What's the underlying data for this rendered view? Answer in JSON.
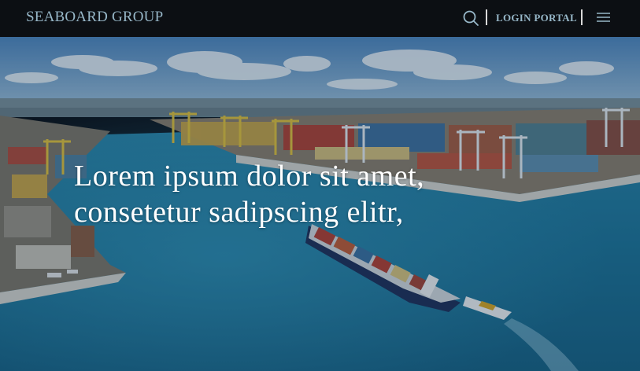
{
  "header": {
    "brand": "SEABOARD GROUP",
    "login_label": "LOGIN PORTAL",
    "icons": [
      "search-icon",
      "hamburger-menu-icon"
    ]
  },
  "hero": {
    "headline_line1": "Lorem ipsum dolor sit amet,",
    "headline_line2": "consetetur sadipscing elitr,"
  },
  "colors": {
    "topbar_bg": "#0c0f13",
    "brand_text": "#97b7c8",
    "separator": "#d9d9d9",
    "headline_text": "#ffffff",
    "water": "#1b6f93"
  }
}
